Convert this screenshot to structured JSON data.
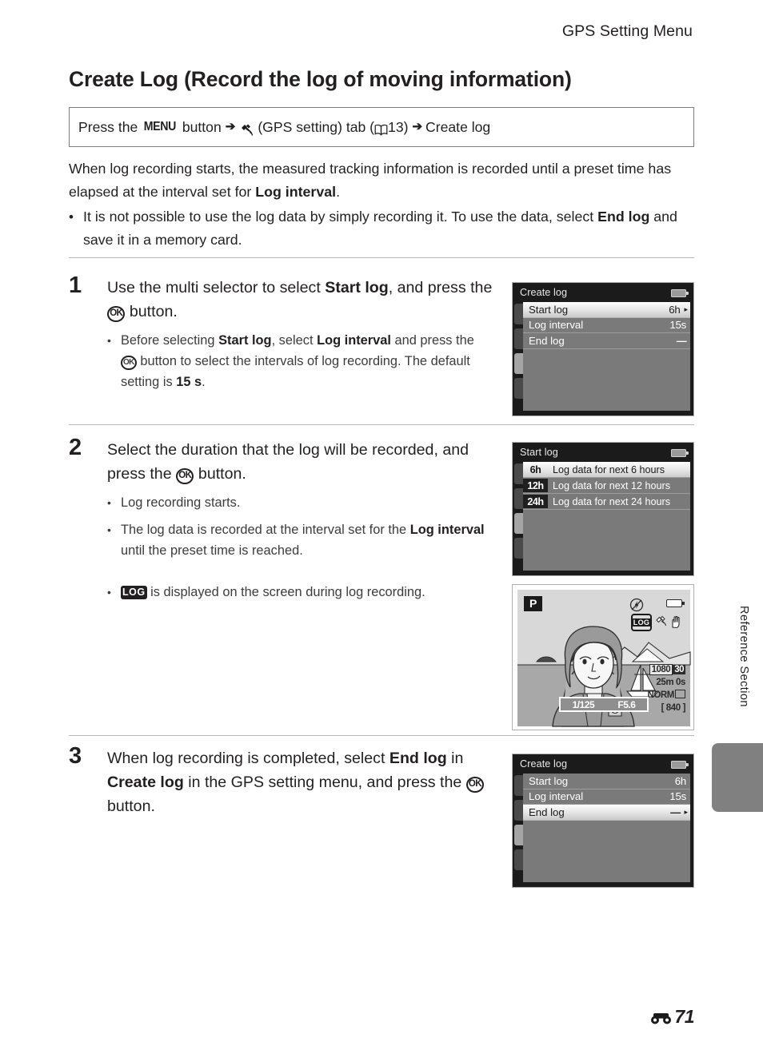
{
  "header": {
    "running_title": "GPS Setting Menu"
  },
  "section": {
    "title": "Create Log (Record the log of moving information)"
  },
  "path_box": {
    "prefix": "Press the",
    "menu_label": "MENU",
    "button_word": "button",
    "gps_icon": "gps-satellite-icon",
    "tab_text": "(GPS setting) tab (",
    "book_icon": "manual-book-icon",
    "page_ref": "13",
    "close_paren": ")",
    "target": "Create log"
  },
  "intro": {
    "para1_a": "When log recording starts, the measured tracking information is recorded until a preset time has elapsed at the interval set for ",
    "para1_bold": "Log interval",
    "para1_b": ".",
    "bullet1_a": "It is not possible to use the log data by simply recording it. To use the data, select ",
    "bullet1_bold": "End log",
    "bullet1_b": " and save it in a memory card."
  },
  "steps": [
    {
      "num": "1",
      "head_a": "Use the multi selector to select ",
      "head_bold": "Start log",
      "head_b": ", and press the ",
      "ok_label": "OK",
      "head_c": " button.",
      "subs": [
        {
          "a": "Before selecting ",
          "b1": "Start log",
          "b": ", select ",
          "b2": "Log interval",
          "c": " and press the ",
          "ok": "OK",
          "d": " button to select the intervals of log recording. The default setting is ",
          "b3": "15 s",
          "e": "."
        }
      ]
    },
    {
      "num": "2",
      "head_a": "Select the duration that the log will be recorded, and press the ",
      "ok_label": "OK",
      "head_c": " button.",
      "subs": [
        {
          "a": "Log recording starts."
        },
        {
          "a": "The log data is recorded at the interval set for the ",
          "b1": "Log interval",
          "b": " until the preset time is reached."
        }
      ],
      "log_bullet": {
        "glyph": "LOG",
        "text": " is displayed on the screen during log recording."
      }
    },
    {
      "num": "3",
      "head_a": "When log recording is completed, select ",
      "head_bold": "End log",
      "head_b": " in ",
      "head_bold2": "Create log",
      "head_b2": " in the GPS setting menu, and press the ",
      "ok_label": "OK",
      "head_c": " button."
    }
  ],
  "screens": {
    "create_log_1": {
      "title": "Create log",
      "battery_icon": "battery-icon",
      "rows": [
        {
          "label": "Start log",
          "value": "6h",
          "selected": true,
          "caret": "▸"
        },
        {
          "label": "Log interval",
          "value": "15s",
          "selected": false,
          "caret": ""
        },
        {
          "label": "End log",
          "value": "––",
          "selected": false,
          "caret": ""
        }
      ]
    },
    "start_log": {
      "title": "Start log",
      "battery_icon": "battery-icon",
      "options": [
        {
          "badge": "6h",
          "label": "Log data for next 6 hours",
          "selected": true
        },
        {
          "badge": "12h",
          "label": "Log data for next 12 hours",
          "selected": false
        },
        {
          "badge": "24h",
          "label": "Log data for next 24 hours",
          "selected": false
        }
      ]
    },
    "live_view": {
      "mode": "P",
      "flash_icon": "flash-off-icon",
      "battery_icon": "battery-icon",
      "log_badge": "LOG",
      "gps_icon": "gps-satellite-icon",
      "vr_icon": "vibration-reduction-icon",
      "movie_size": "1080",
      "frame_rate": "30",
      "rec_time": "25m 0s",
      "image_quality": "NORM",
      "shots_remaining": "[  840 ]",
      "shutter_speed": "1/125",
      "aperture": "F5.6"
    },
    "create_log_2": {
      "title": "Create log",
      "battery_icon": "battery-icon",
      "rows": [
        {
          "label": "Start log",
          "value": "6h",
          "selected": false,
          "caret": ""
        },
        {
          "label": "Log interval",
          "value": "15s",
          "selected": false,
          "caret": ""
        },
        {
          "label": "End log",
          "value": "––",
          "selected": true,
          "caret": "▸"
        }
      ]
    }
  },
  "side": {
    "label": "Reference Section"
  },
  "footer": {
    "section_icon": "reference-section-icon",
    "page_number": "71"
  }
}
